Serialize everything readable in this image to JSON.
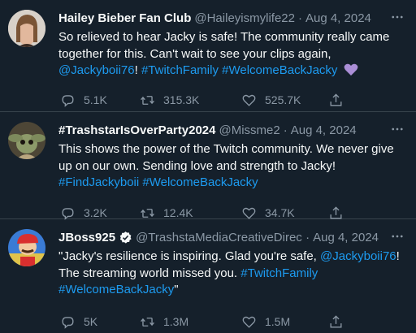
{
  "tweets": [
    {
      "author": "Hailey Bieber Fan Club",
      "handle": "@Haileyismylife22",
      "date": "Aug 4, 2024",
      "text_plain": "So relieved to hear Jacky is safe! The community really came together for this. Can't wait to see your clips again,",
      "mention": "@Jackyboii76",
      "after_mention": "!",
      "hashtags": [
        "#TwitchFamily",
        "#WelcomeBackJacky"
      ],
      "emoji": "purple-heart",
      "replies": "5.1K",
      "retweets": "315.3K",
      "likes": "525.7K"
    },
    {
      "author": "#TrashstarIsOverParty2024",
      "handle": "@Missme2",
      "date": "Aug 4, 2024",
      "text_plain": "This shows the power of the Twitch community. We never give up on our own. Sending love and strength to Jacky!",
      "hashtags": [
        "#FindJackyboii",
        "#WelcomeBackJacky"
      ],
      "replies": "3.2K",
      "retweets": "12.4K",
      "likes": "34.7K"
    },
    {
      "author": "JBoss925",
      "handle": "@TrashstaMediaCreativeDirect",
      "date": "Aug 4, 2024",
      "text_before": "\"Jacky's resilience is inspiring. Glad you're safe,",
      "mention": "@Jackyboii76",
      "text_after": "! The streaming world missed you.",
      "hashtags": [
        "#TwitchFamily",
        "#WelcomeBackJacky"
      ],
      "closing": "\"",
      "replies": "5K",
      "retweets": "1.3M",
      "likes": "1.5M"
    }
  ],
  "icons": {
    "reply": "reply-icon",
    "retweet": "retweet-icon",
    "like": "heart-icon",
    "share": "share-icon",
    "more": "more-icon",
    "verified": "verified-badge-icon"
  },
  "colors": {
    "background": "#15202b",
    "text": "#f7f9f9",
    "secondary": "#8b98a5",
    "link": "#1d9bf0",
    "divider": "#38444d"
  }
}
